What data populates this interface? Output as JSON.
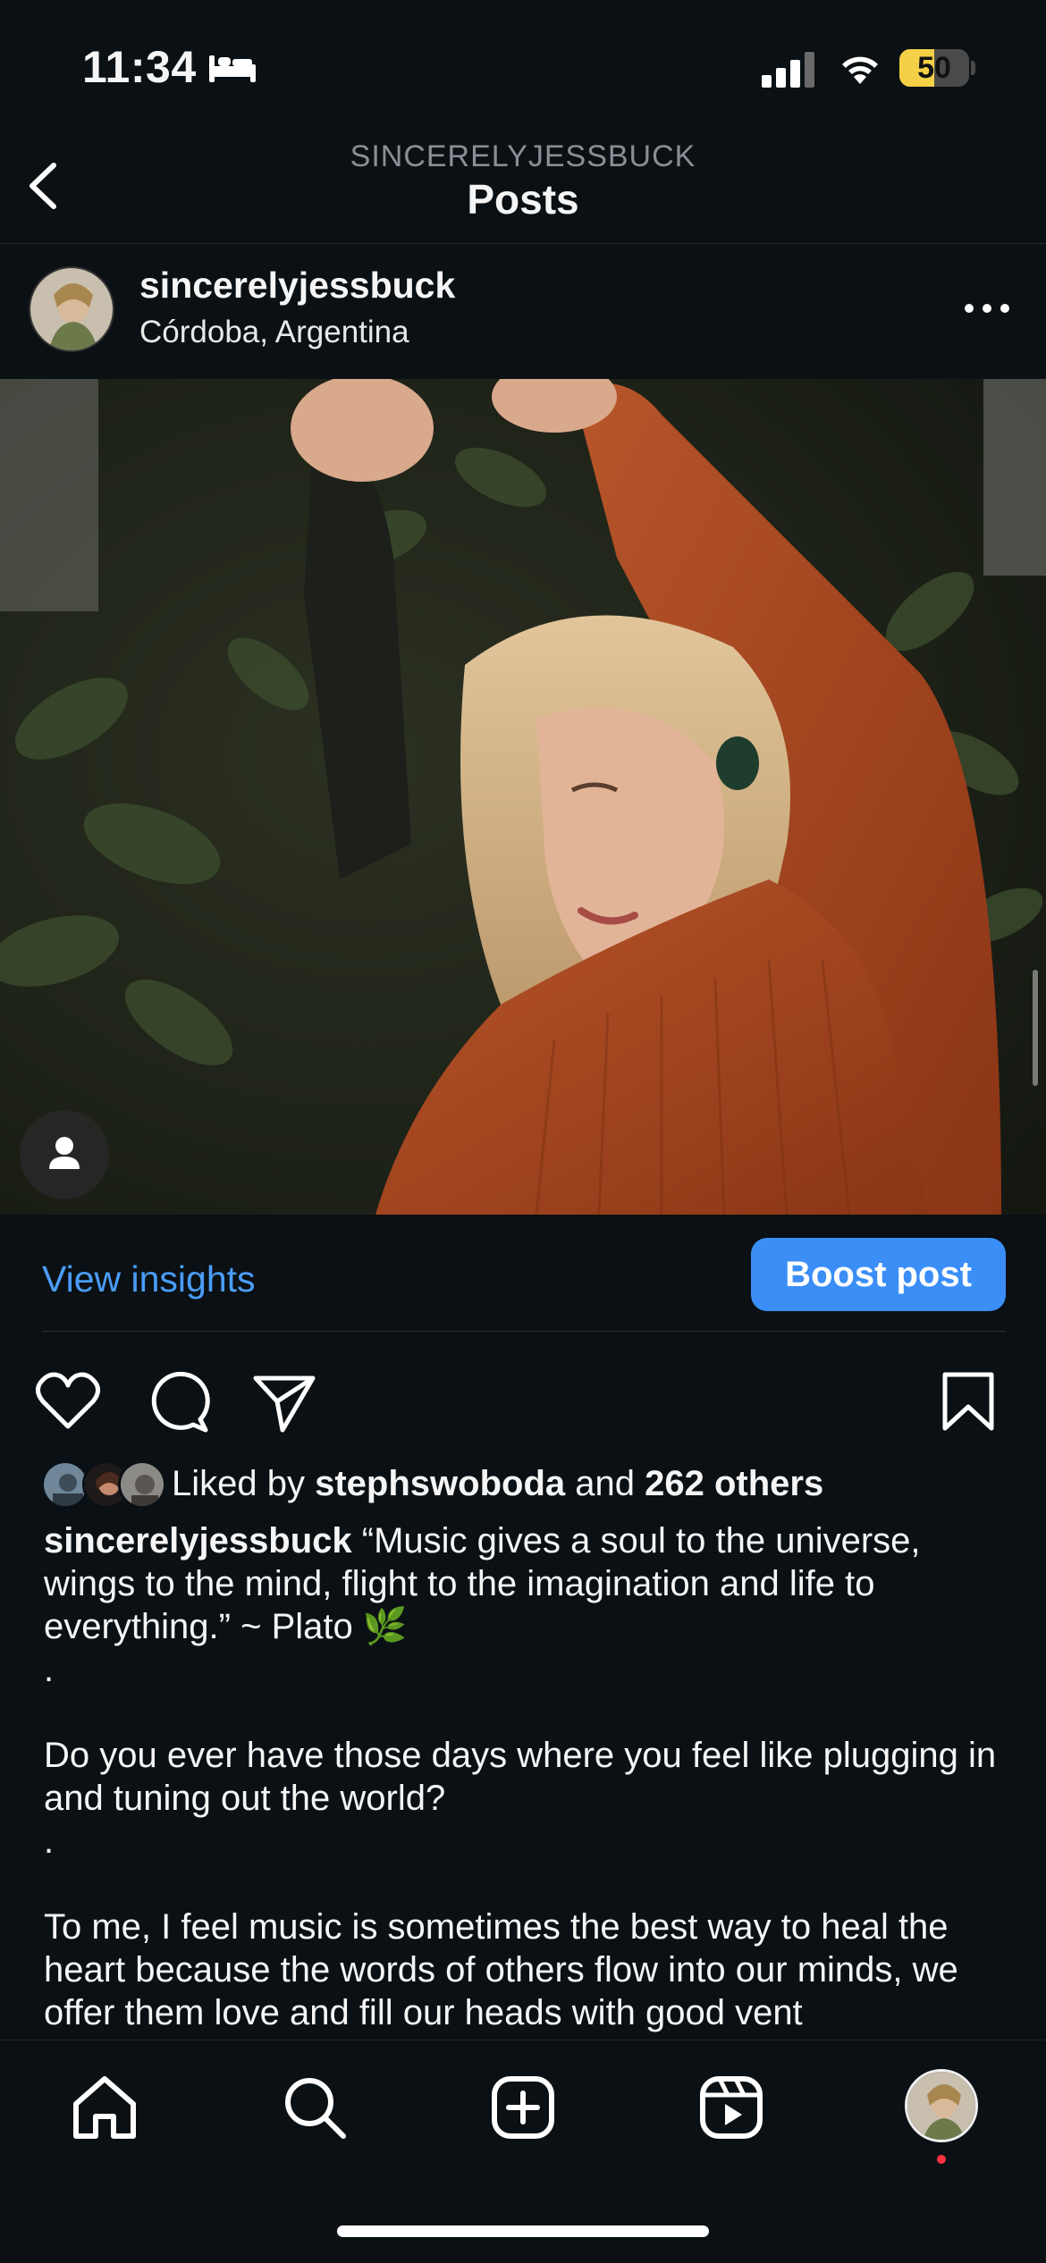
{
  "status_bar": {
    "time": "11:34",
    "battery": "50",
    "battery_level": 0.5,
    "icons": [
      "bed-icon",
      "signal-icon",
      "wifi-icon",
      "battery-icon"
    ]
  },
  "header": {
    "subtitle": "SINCERELYJESSBUCK",
    "title": "Posts"
  },
  "post": {
    "username": "sincerelyjessbuck",
    "location": "Córdoba, Argentina"
  },
  "insights": {
    "view_label": "View insights",
    "boost_label": "Boost post"
  },
  "likes": {
    "prefix": "Liked by ",
    "user": "stephswoboda",
    "middle": " and ",
    "others": "262 others"
  },
  "caption": {
    "username": "sincerelyjessbuck",
    "quote": " “Music gives a soul to the universe, wings to the mind, flight to the imagination and life to everything.” ~ Plato 🌿",
    "dot1": ".",
    "para2": "Do you ever have those days where you feel like plugging in and tuning out the world?",
    "dot2": ".",
    "para3": "To me, I feel music is sometimes the best way to heal the heart because the words of others flow into our minds, we offer them love and fill our heads with good vent"
  },
  "tab_bar": {
    "items": [
      "home-icon",
      "search-icon",
      "create-icon",
      "reels-icon",
      "profile-avatar"
    ]
  },
  "colors": {
    "background": "#0b1014",
    "link_blue": "#4a9df8",
    "button_blue": "#3a8ef6",
    "battery_yellow": "#f3d045"
  }
}
